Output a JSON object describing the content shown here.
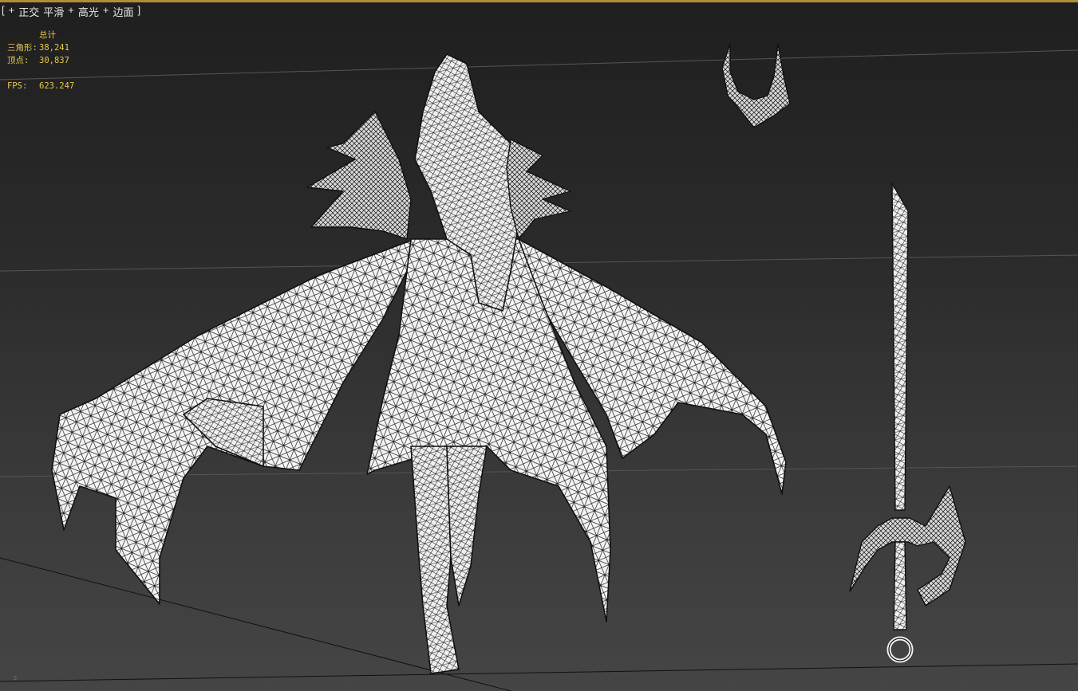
{
  "viewport": {
    "label": {
      "open": "[",
      "plus": "+",
      "view_mode": "正交",
      "shading": "平滑",
      "shading_opt1": "高光",
      "shading_opt2": "边面",
      "close": "]"
    },
    "stats": {
      "header": "总计",
      "triangles_label": "三角形:",
      "triangles_value": "38,241",
      "vertices_label": "顶点:",
      "vertices_value": "30,837",
      "fps_label": "FPS:",
      "fps_value": "623.247"
    },
    "axis_label": "z",
    "colors": {
      "border": "#b38b3a",
      "stats_text": "#e8c64a",
      "wire": "#111111",
      "model_fill": "#f2f2f2"
    }
  }
}
